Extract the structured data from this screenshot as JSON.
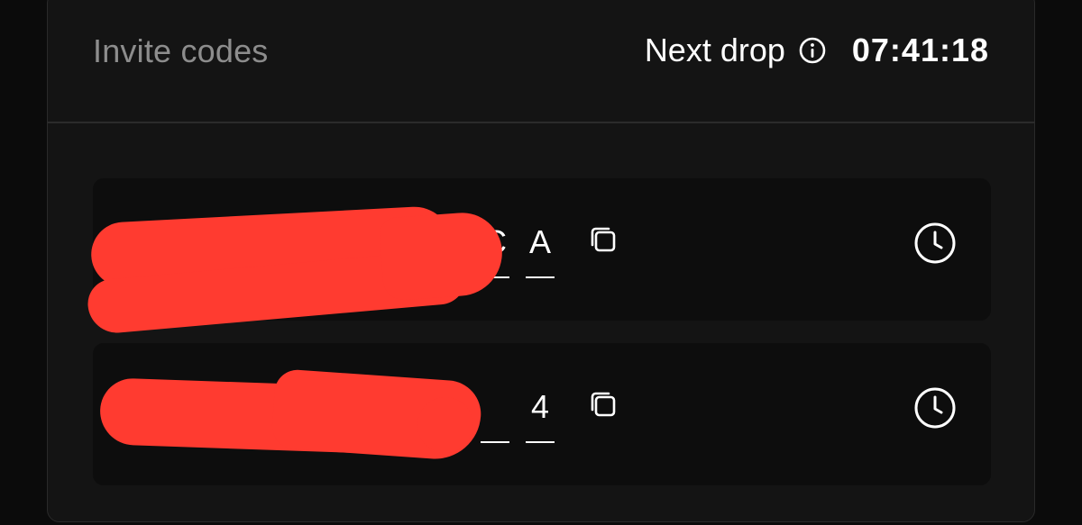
{
  "header": {
    "title": "Invite codes",
    "next_drop_label": "Next drop",
    "countdown": "07:41:18"
  },
  "invite_codes": [
    {
      "visible_chars": [
        "C",
        "A"
      ]
    },
    {
      "visible_chars": [
        "",
        "4"
      ]
    }
  ],
  "colors": {
    "background": "#0b0b0b",
    "panel": "#141414",
    "row": "#0d0d0d",
    "muted_text": "#8d8d8d",
    "redaction": "#ff3b30"
  },
  "icons": [
    "info-icon",
    "copy-icon",
    "clock-icon"
  ]
}
